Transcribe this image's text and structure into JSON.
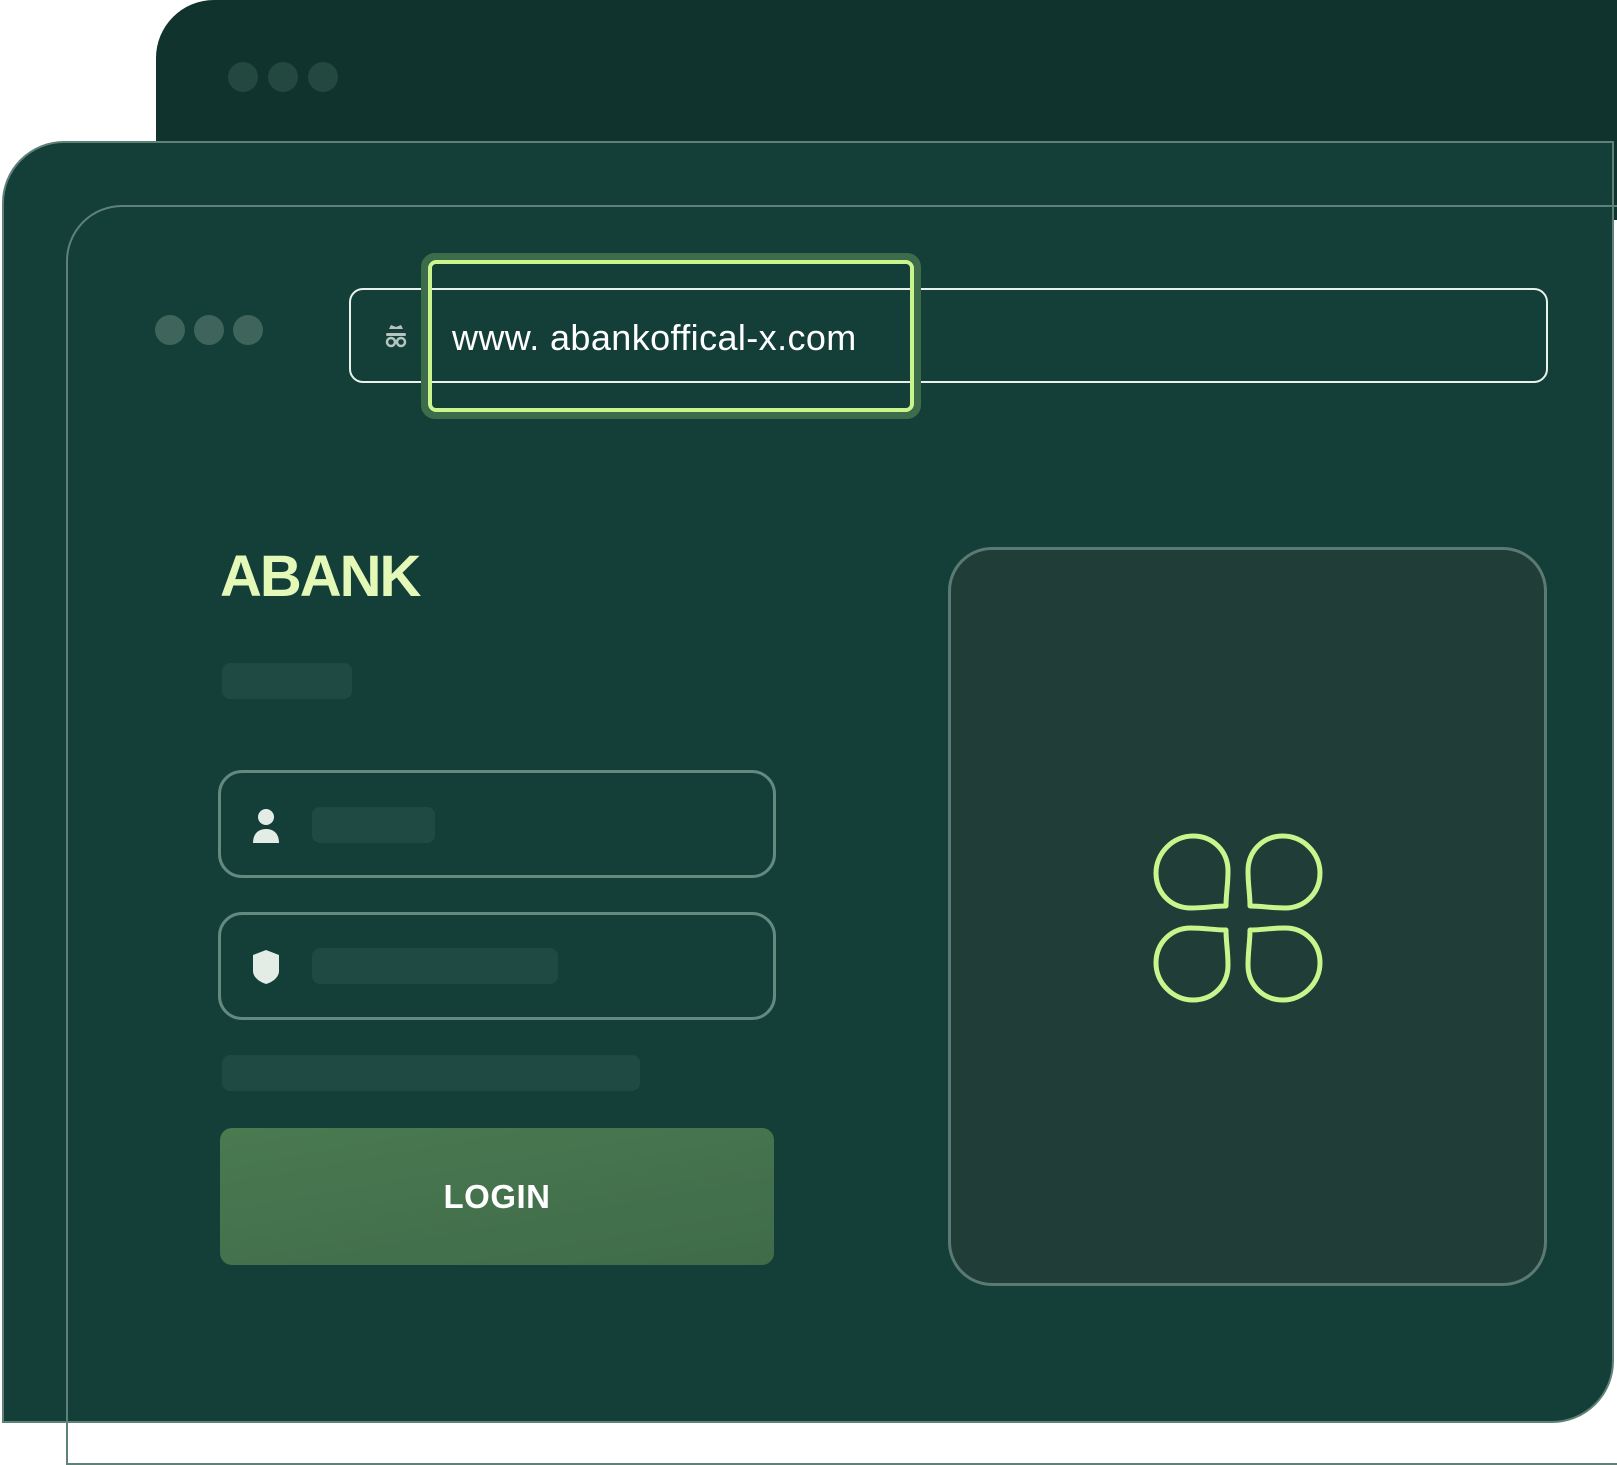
{
  "browser": {
    "url": "www. abankoffical-x.com",
    "address_icon": "incognito-spy-icon"
  },
  "login": {
    "brand": "ABANK",
    "username_icon": "user-icon",
    "password_icon": "shield-icon",
    "button_label": "LOGIN"
  },
  "side_panel": {
    "icon": "command-key-icon"
  },
  "colors": {
    "window_back": "#10342d",
    "window_front": "#143f39",
    "accent": "#c9f58c",
    "brand_text": "#e4f9b8",
    "button": "#447249",
    "panel": "#213d38"
  }
}
